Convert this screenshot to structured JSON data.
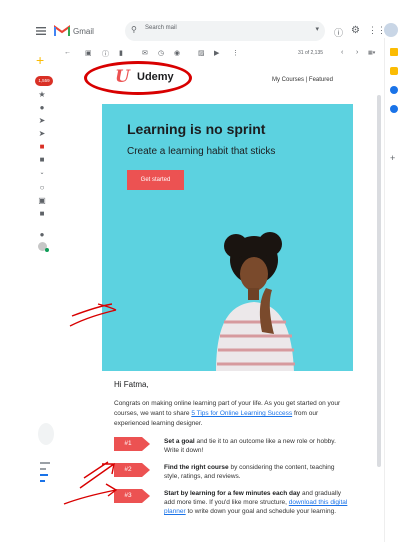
{
  "gmail": {
    "brand": "Gmail",
    "search_placeholder": "Search mail",
    "page_counter": "31 of 2,135",
    "unread_badge": "1,559"
  },
  "email": {
    "logo_text": "Udemy",
    "nav_links": "My Courses | Featured",
    "hero": {
      "title": "Learning is no sprint",
      "subtitle": "Create a learning habit that sticks",
      "button": "Get started"
    },
    "greeting": "Hi Fatma,",
    "intro_pre": "Congrats on making online learning part of your life. As you get started on your courses, we want to share ",
    "intro_link": "5 Tips for Online Learning Success",
    "intro_post": " from our experienced learning designer.",
    "steps": [
      {
        "badge": "#1",
        "bold": "Set a goal",
        "text": " and tie it to an outcome like a new role or hobby. Write it down!"
      },
      {
        "badge": "#2",
        "bold": "Find the right course",
        "text": " by considering the content, teaching style, ratings, and reviews."
      },
      {
        "badge": "#3",
        "bold": "Start by learning for a few minutes each day",
        "text": " and gradually add more time. If you'd like more structure, ",
        "link": "download this digital planner",
        "post": " to write down your goal and schedule your learning."
      }
    ]
  },
  "colors": {
    "accent": "#ec5252",
    "hero_bg": "#5cd2e0",
    "annotation": "#d80000"
  }
}
